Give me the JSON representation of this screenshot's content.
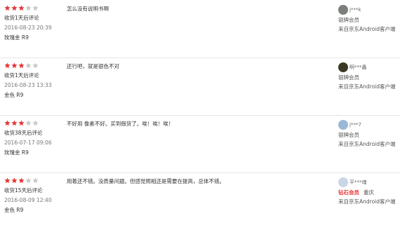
{
  "reviews": [
    {
      "stars": 3,
      "purchase_note": "收货1天后评论",
      "date": "2016-08-23 20:39",
      "color": "玫瑰金 R9",
      "comment": "怎么没有说明书啊",
      "user": "j***k",
      "level": "银牌会员",
      "location": "",
      "source": "来自京东Android客户端",
      "avatar_color": "#7a7f7a"
    },
    {
      "stars": 3,
      "purchase_note": "收货1天后评论",
      "date": "2016-08-23 13:33",
      "color": "金色 R9",
      "comment": "还行吧，就是银色不对",
      "user": "啊***鑫",
      "level": "银牌会员",
      "location": "",
      "source": "来自京东Android客户端",
      "avatar_color": "#3a3a24"
    },
    {
      "stars": 3,
      "purchase_note": "收货38天后评论",
      "date": "2016-07-17 09:06",
      "color": "玫瑰金 R9",
      "comment": "不好用 像素不好。买到假货了。唉！唉！唉！",
      "user": "j***7",
      "level": "银牌会员",
      "location": "",
      "source": "来自京东Android客户端",
      "avatar_color": "#9ab7d6"
    },
    {
      "stars": 3,
      "purchase_note": "收货15天后评论",
      "date": "2016-08-09 12:40",
      "color": "金色 R9",
      "comment": "用着还不错。没质量问题。但感觉照相还是需要在提高，总体不错。",
      "user": "平***魂",
      "level": "钻石会员",
      "location": "重庆",
      "source": "来自京东Android客户端",
      "avatar_color": "#c9d6e6"
    }
  ],
  "colors": {
    "star_filled": "#e4393c",
    "star_empty": "#c8c8c8",
    "diamond_level": "#e4393c"
  }
}
